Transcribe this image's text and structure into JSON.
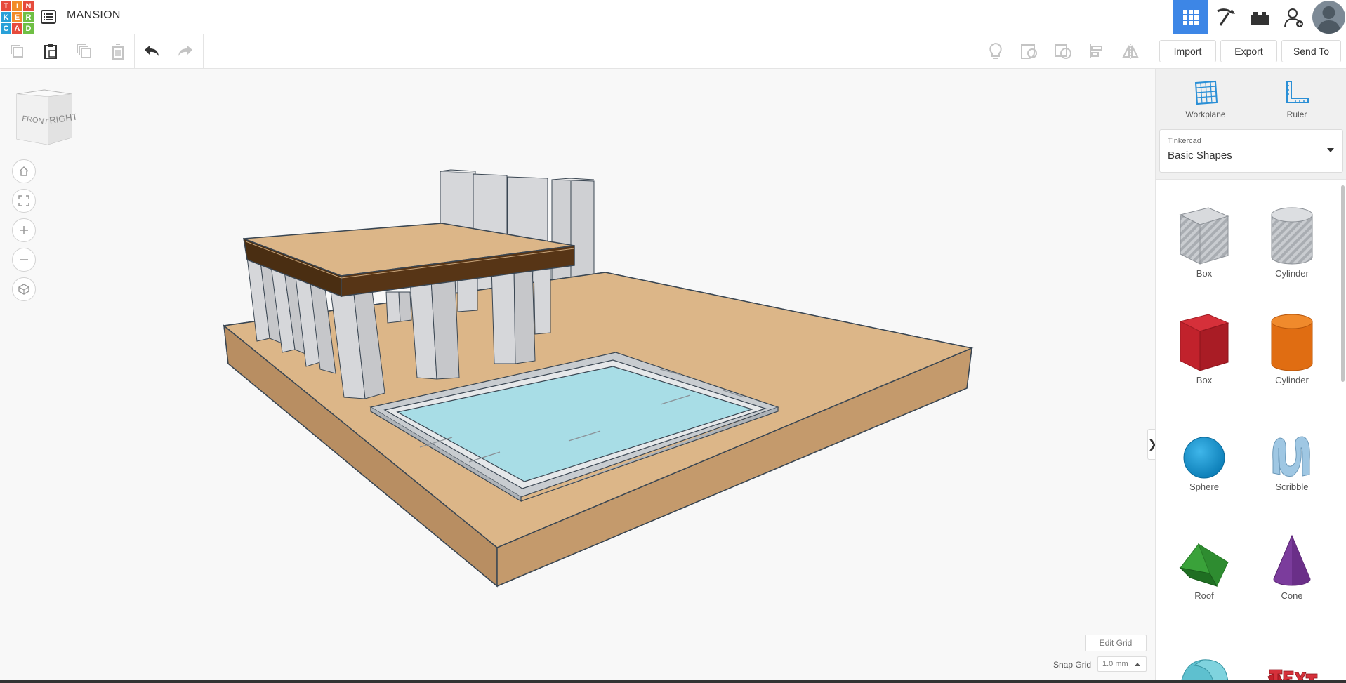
{
  "logo": {
    "letters": [
      "T",
      "I",
      "N",
      "K",
      "E",
      "R",
      "C",
      "A",
      "D"
    ],
    "colors": [
      "#e64b3c",
      "#f28b28",
      "#e64b3c",
      "#28a0d8",
      "#f28b28",
      "#6fbf44",
      "#28a0d8",
      "#e64b3c",
      "#6fbf44"
    ]
  },
  "header": {
    "title": "MANSION",
    "menu_icon": "list-icon"
  },
  "top_icons": [
    "grid-view-icon",
    "pickaxe-icon",
    "bricks-icon",
    "add-user-icon",
    "avatar"
  ],
  "toolbar": {
    "import_label": "Import",
    "export_label": "Export",
    "send_to_label": "Send To"
  },
  "view_controls": [
    "home-icon",
    "fit-icon",
    "zoom-in-icon",
    "zoom-out-icon",
    "perspective-icon"
  ],
  "view_cube": {
    "front": "FRONT",
    "right": "RIGHT"
  },
  "grid": {
    "edit_label": "Edit Grid",
    "snap_label": "Snap Grid",
    "snap_value": "1.0 mm"
  },
  "panel": {
    "workplane_label": "Workplane",
    "ruler_label": "Ruler",
    "library_source": "Tinkercad",
    "library_name": "Basic Shapes"
  },
  "shapes": [
    {
      "label": "Box",
      "icon": "box-hole-icon"
    },
    {
      "label": "Cylinder",
      "icon": "cylinder-hole-icon"
    },
    {
      "label": "Box",
      "icon": "box-icon"
    },
    {
      "label": "Cylinder",
      "icon": "cylinder-icon"
    },
    {
      "label": "Sphere",
      "icon": "sphere-icon"
    },
    {
      "label": "Scribble",
      "icon": "scribble-icon"
    },
    {
      "label": "Roof",
      "icon": "roof-icon"
    },
    {
      "label": "Cone",
      "icon": "cone-icon"
    }
  ],
  "colors": {
    "accent": "#3d86e6",
    "sand": "#dcb688",
    "pool": "#a8dde6",
    "beam": "#4a2e12"
  }
}
